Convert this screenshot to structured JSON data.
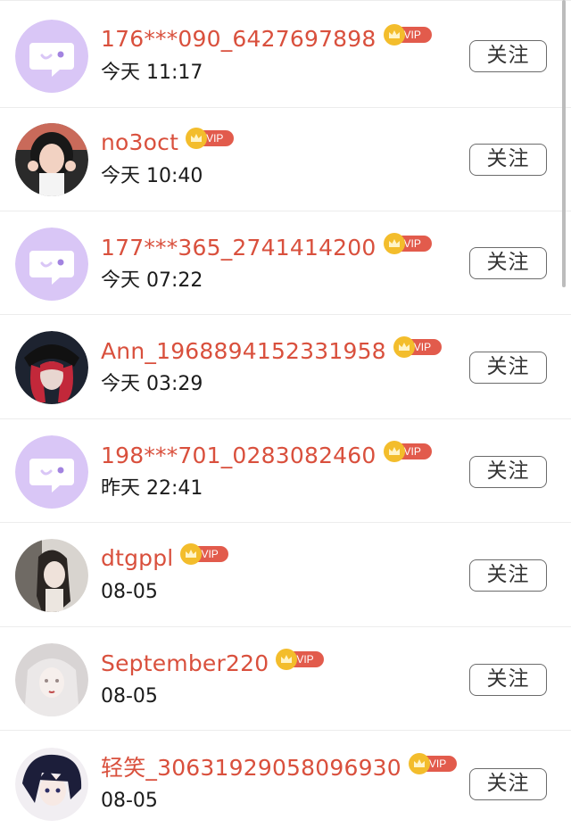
{
  "follow_label": "关注",
  "vip_label": "VIP",
  "colors": {
    "username": "#d9503d",
    "vip_badge": "#e25b4c",
    "crown": "#f3bd2c",
    "default_avatar_bg": "#d9c6f6"
  },
  "users": [
    {
      "name": "176***090_6427697898",
      "time": "今天 11:17",
      "avatar": "default-chat-bubble-avatar"
    },
    {
      "name": "no3oct",
      "time": "今天 10:40",
      "avatar": "girl-photo-avatar"
    },
    {
      "name": "177***365_2741414200",
      "time": "今天 07:22",
      "avatar": "default-chat-bubble-avatar"
    },
    {
      "name": "Ann_1968894152331958",
      "time": "今天 03:29",
      "avatar": "anime-red-hair-avatar"
    },
    {
      "name": "198***701_0283082460",
      "time": "昨天 22:41",
      "avatar": "default-chat-bubble-avatar"
    },
    {
      "name": "dtgppl",
      "time": "08-05",
      "avatar": "woman-portrait-avatar"
    },
    {
      "name": "September220",
      "time": "08-05",
      "avatar": "illustrated-pale-girl-avatar"
    },
    {
      "name": "轻笑_30631929058096930",
      "time": "08-05",
      "avatar": "anime-dark-hair-avatar"
    }
  ]
}
